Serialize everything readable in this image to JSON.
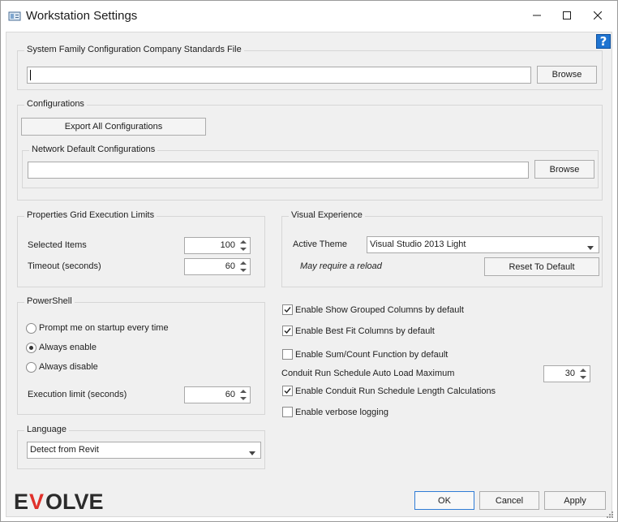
{
  "window": {
    "title": "Workstation Settings",
    "help_label": "?"
  },
  "standards_file": {
    "group_label": "System Family Configuration Company Standards File",
    "path_value": "",
    "browse_label": "Browse"
  },
  "configurations": {
    "group_label": "Configurations",
    "export_label": "Export All Configurations",
    "network_group_label": "Network Default Configurations",
    "network_path_value": "",
    "browse_label": "Browse"
  },
  "properties_grid": {
    "group_label": "Properties Grid Execution Limits",
    "selected_items_label": "Selected Items",
    "selected_items_value": "100",
    "timeout_label": "Timeout (seconds)",
    "timeout_value": "60"
  },
  "visual_experience": {
    "group_label": "Visual Experience",
    "theme_label": "Active Theme",
    "theme_value": "Visual Studio 2013 Light",
    "reload_note": "May require a reload",
    "reset_label": "Reset To Default"
  },
  "powershell": {
    "group_label": "PowerShell",
    "options": [
      {
        "label": "Prompt me on startup every time",
        "selected": false
      },
      {
        "label": "Always enable",
        "selected": true
      },
      {
        "label": "Always disable",
        "selected": false
      }
    ],
    "exec_limit_label": "Execution limit (seconds)",
    "exec_limit_value": "60"
  },
  "options": {
    "show_grouped": {
      "label": "Enable Show Grouped Columns by default",
      "checked": true
    },
    "best_fit": {
      "label": "Enable Best Fit Columns by default",
      "checked": true
    },
    "sum_count": {
      "label": "Enable Sum/Count Function by default",
      "checked": false
    },
    "conduit_max_label": "Conduit Run Schedule Auto Load Maximum",
    "conduit_max_value": "30",
    "conduit_calc": {
      "label": "Enable Conduit Run Schedule Length Calculations",
      "checked": true
    },
    "verbose": {
      "label": "Enable verbose logging",
      "checked": false
    }
  },
  "language": {
    "group_label": "Language",
    "value": "Detect from Revit"
  },
  "footer": {
    "logo_text": "EVOLVE",
    "ok_label": "OK",
    "cancel_label": "Cancel",
    "apply_label": "Apply"
  },
  "colors": {
    "accent": "#2f7cd6",
    "help_blue": "#1f74d1",
    "logo_red": "#e0312b",
    "logo_dark": "#2b2b2b"
  },
  "icons": {
    "app": "window-settings-icon",
    "minimize": "minimize-icon",
    "maximize": "maximize-icon",
    "close": "close-icon",
    "help": "help-icon",
    "dropdown": "chevron-down-icon",
    "spinner": "spinner-arrows-icon",
    "checkbox": "check-icon"
  }
}
